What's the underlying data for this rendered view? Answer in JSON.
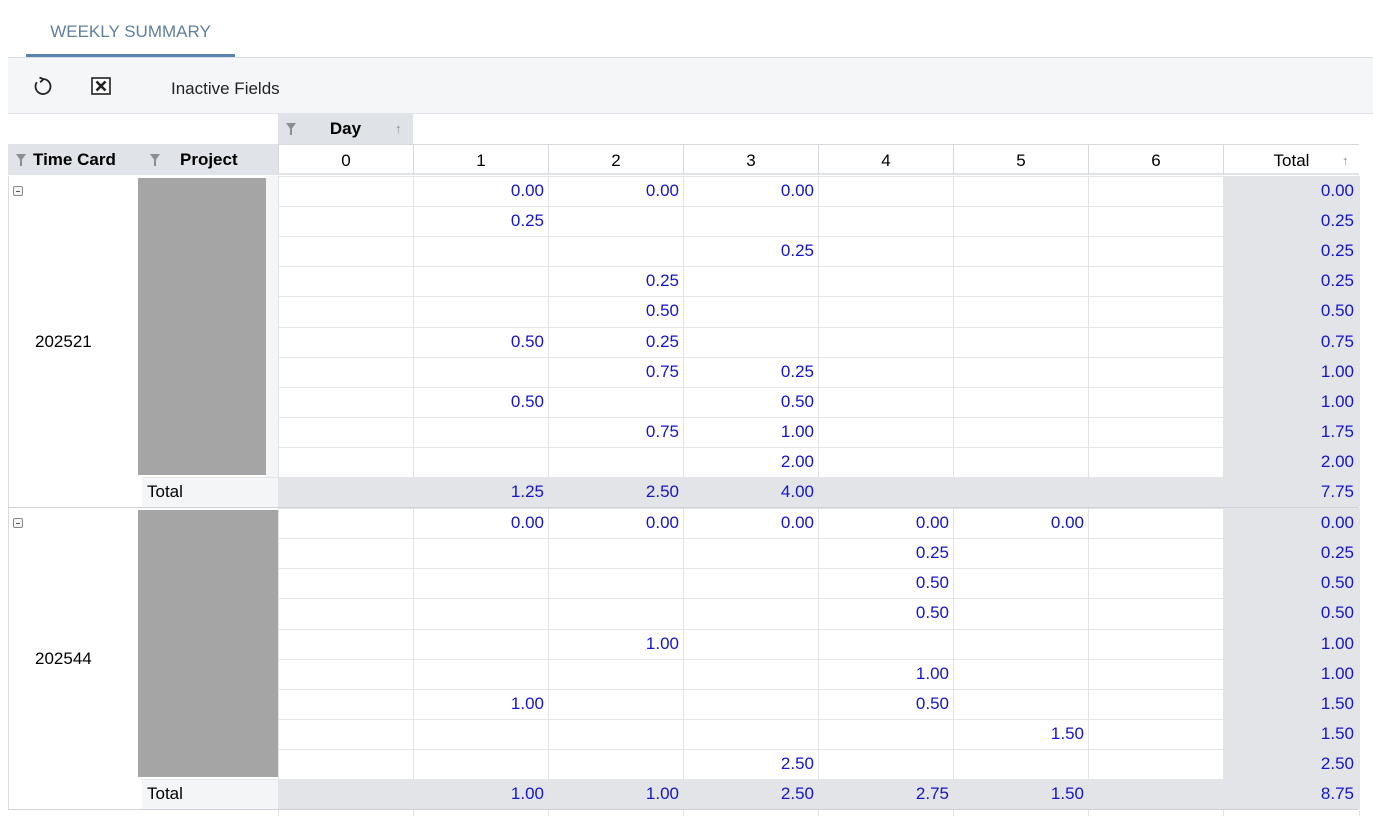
{
  "tab": {
    "label": "WEEKLY SUMMARY"
  },
  "toolbar": {
    "refresh_icon": "refresh-icon",
    "excel_icon": "excel-export-icon",
    "inactive_fields": "Inactive Fields"
  },
  "pivot": {
    "column_field": "Day",
    "row_fields": [
      "Time Card",
      "Project"
    ],
    "columns": [
      "0",
      "1",
      "2",
      "3",
      "4",
      "5",
      "6",
      "Total"
    ],
    "total_label": "Total",
    "groups": [
      {
        "time_card": "202521",
        "rows": [
          [
            "",
            "0.00",
            "0.00",
            "0.00",
            "",
            "",
            "",
            "0.00"
          ],
          [
            "",
            "0.25",
            "",
            "",
            "",
            "",
            "",
            "0.25"
          ],
          [
            "",
            "",
            "",
            "0.25",
            "",
            "",
            "",
            "0.25"
          ],
          [
            "",
            "",
            "0.25",
            "",
            "",
            "",
            "",
            "0.25"
          ],
          [
            "",
            "",
            "0.50",
            "",
            "",
            "",
            "",
            "0.50"
          ],
          [
            "",
            "0.50",
            "0.25",
            "",
            "",
            "",
            "",
            "0.75"
          ],
          [
            "",
            "",
            "0.75",
            "0.25",
            "",
            "",
            "",
            "1.00"
          ],
          [
            "",
            "0.50",
            "",
            "0.50",
            "",
            "",
            "",
            "1.00"
          ],
          [
            "",
            "",
            "0.75",
            "1.00",
            "",
            "",
            "",
            "1.75"
          ],
          [
            "",
            "",
            "",
            "2.00",
            "",
            "",
            "",
            "2.00"
          ]
        ],
        "total": [
          "",
          "1.25",
          "2.50",
          "4.00",
          "",
          "",
          "",
          "7.75"
        ]
      },
      {
        "time_card": "202544",
        "rows": [
          [
            "",
            "0.00",
            "0.00",
            "0.00",
            "0.00",
            "0.00",
            "",
            "0.00"
          ],
          [
            "",
            "",
            "",
            "",
            "0.25",
            "",
            "",
            "0.25"
          ],
          [
            "",
            "",
            "",
            "",
            "0.50",
            "",
            "",
            "0.50"
          ],
          [
            "",
            "",
            "",
            "",
            "0.50",
            "",
            "",
            "0.50"
          ],
          [
            "",
            "",
            "1.00",
            "",
            "",
            "",
            "",
            "1.00"
          ],
          [
            "",
            "",
            "",
            "",
            "1.00",
            "",
            "",
            "1.00"
          ],
          [
            "",
            "1.00",
            "",
            "",
            "0.50",
            "",
            "",
            "1.50"
          ],
          [
            "",
            "",
            "",
            "",
            "",
            "1.50",
            "",
            "1.50"
          ],
          [
            "",
            "",
            "",
            "2.50",
            "",
            "",
            "",
            "2.50"
          ]
        ],
        "total": [
          "",
          "1.00",
          "1.00",
          "2.50",
          "2.75",
          "1.50",
          "",
          "8.75"
        ]
      }
    ]
  }
}
